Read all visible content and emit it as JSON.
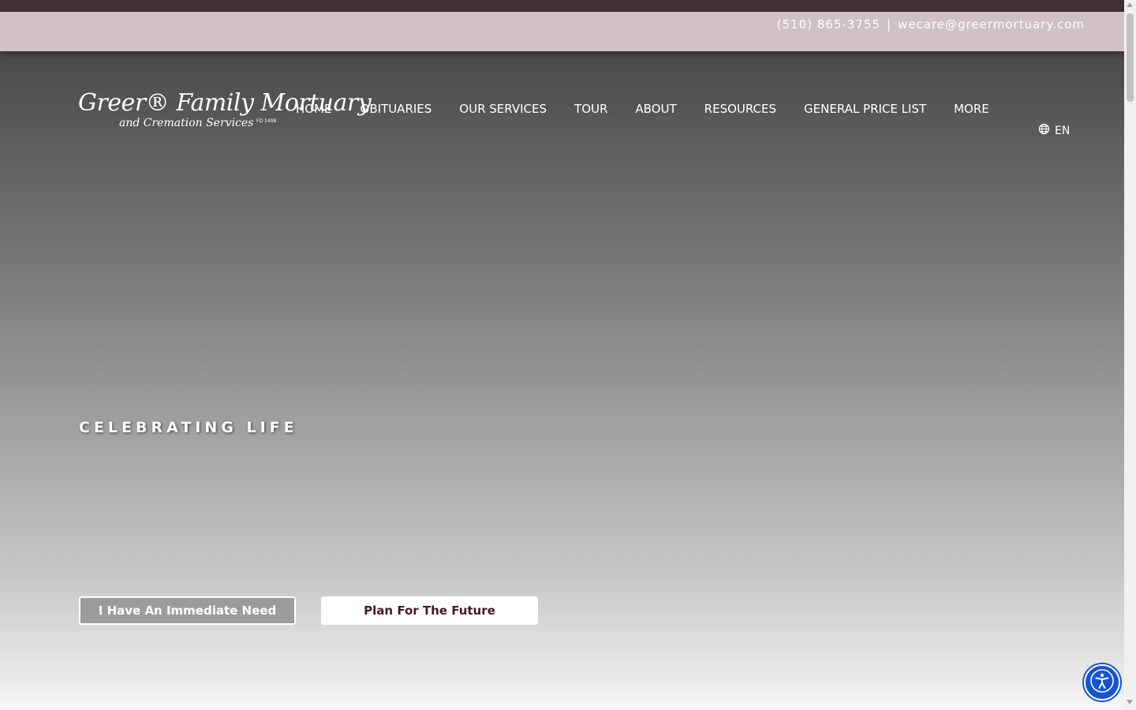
{
  "contact": {
    "phone": "(510) 865-3755",
    "separator": "|",
    "email": "wecare@greermortuary.com"
  },
  "logo": {
    "line1": "Greer® Family Mortuary",
    "line2": "and Cremation Services",
    "fd": "FD 1408"
  },
  "nav": {
    "items": [
      {
        "label": "HOME"
      },
      {
        "label": "OBITUARIES"
      },
      {
        "label": "OUR SERVICES"
      },
      {
        "label": "TOUR"
      },
      {
        "label": "ABOUT"
      },
      {
        "label": "RESOURCES"
      },
      {
        "label": "GENERAL PRICE LIST"
      },
      {
        "label": "MORE"
      }
    ],
    "language": "EN"
  },
  "hero": {
    "title": "CELEBRATING LIFE",
    "btn_immediate": "I Have An Immediate Need",
    "btn_future": "Plan For The Future"
  },
  "icons": {
    "language": "globe-icon",
    "accessibility": "accessibility-icon"
  },
  "colors": {
    "top_strip": "#3f3136",
    "contact_bar": "#cfc1c4",
    "future_button_text": "#4a1820",
    "accessibility_button": "#1453d6"
  }
}
